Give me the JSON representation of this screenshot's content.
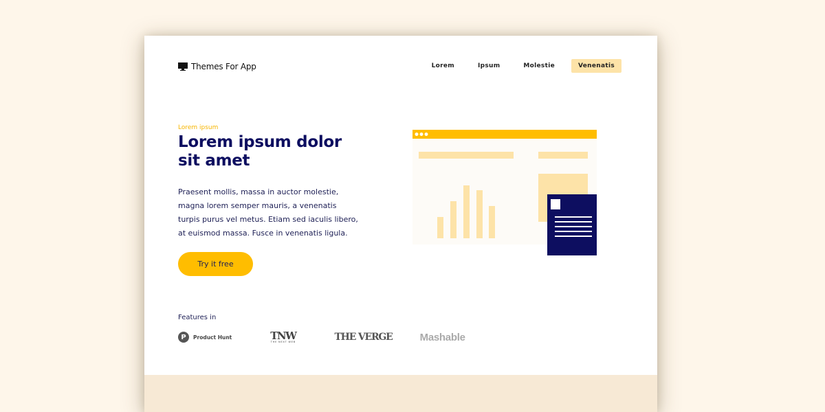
{
  "brand": {
    "name": "Themes For App",
    "icon": "monitor-icon"
  },
  "nav": {
    "items": [
      {
        "label": "Lorem"
      },
      {
        "label": "Ipsum"
      },
      {
        "label": "Molestie"
      },
      {
        "label": "Venenatis"
      }
    ]
  },
  "hero": {
    "eyebrow": "Lorem ipsum",
    "title": "Lorem ipsum dolor sit amet",
    "description": "Praesent mollis, massa in auctor molestie, magna lorem semper mauris, a venenatis turpis purus vel metus. Etiam sed iaculis libero, at euismod massa. Fusce in venenatis ligula.",
    "cta_label": "Try it free"
  },
  "features": {
    "label": "Features in",
    "logos": {
      "producthunt_mark": "P",
      "producthunt_name": "Product Hunt",
      "tnw_main": "TNW",
      "tnw_sub": "THE NEXT WEB",
      "verge": "THE VERGE",
      "mashable": "Mashable"
    }
  },
  "colors": {
    "background": "#fef6ea",
    "accent": "#ffbd00",
    "navy": "#0d0e60",
    "light_yellow": "#fde3a8",
    "footer_band": "#f7e9d5"
  }
}
